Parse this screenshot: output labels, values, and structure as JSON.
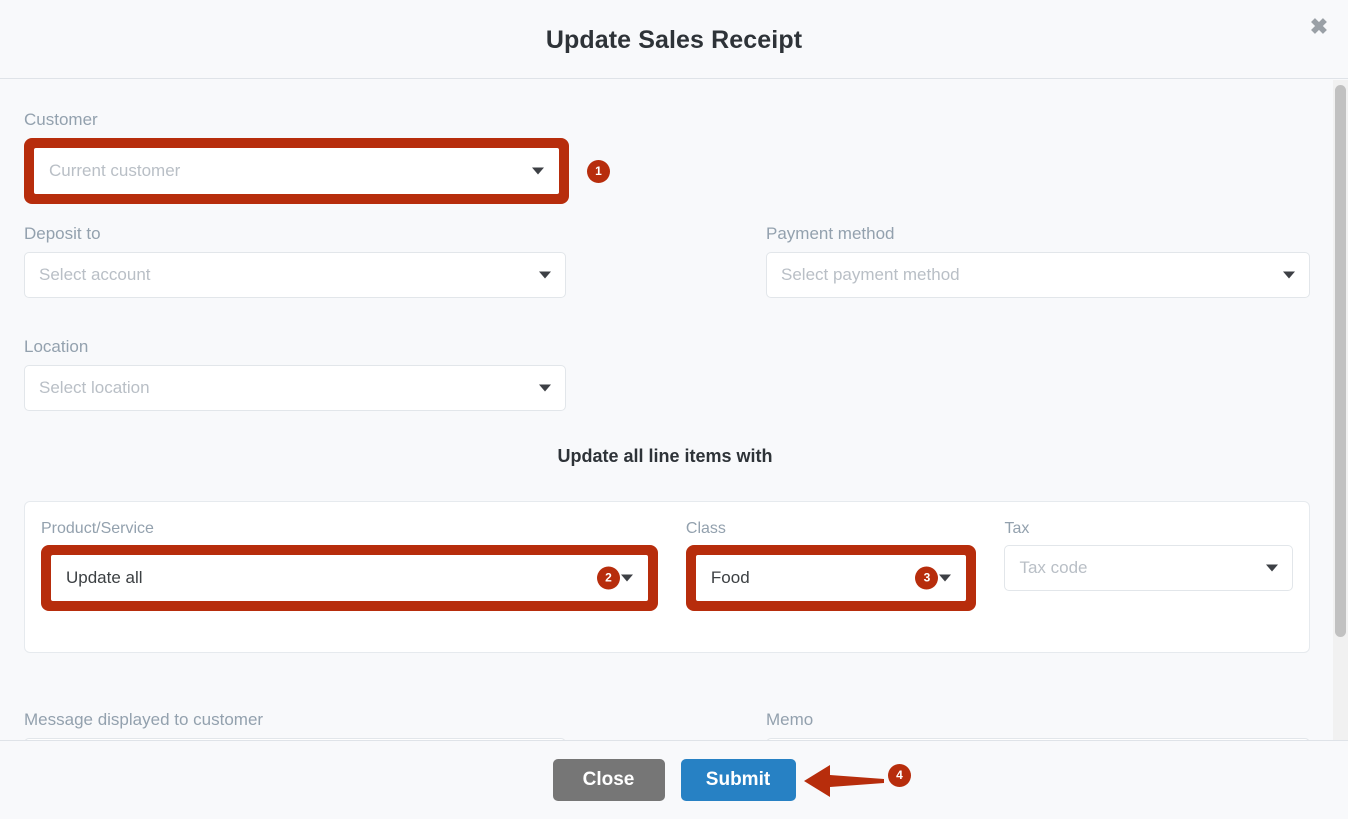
{
  "header": {
    "title": "Update Sales Receipt",
    "close_icon": "close-icon",
    "close_glyph": "✖"
  },
  "form": {
    "customer": {
      "label": "Customer",
      "placeholder": "Current customer",
      "value": "",
      "badge": "1",
      "highlighted": true
    },
    "deposit_to": {
      "label": "Deposit to",
      "placeholder": "Select account",
      "value": ""
    },
    "payment_method": {
      "label": "Payment method",
      "placeholder": "Select payment method",
      "value": ""
    },
    "location": {
      "label": "Location",
      "placeholder": "Select location",
      "value": ""
    }
  },
  "line_items_section": {
    "title": "Update all line items with",
    "product_service": {
      "label": "Product/Service",
      "value": "Update all",
      "badge": "2",
      "highlighted": true
    },
    "class": {
      "label": "Class",
      "value": "Food",
      "badge": "3",
      "highlighted": true
    },
    "tax": {
      "label": "Tax",
      "placeholder": "Tax code",
      "value": ""
    }
  },
  "bottom": {
    "message": {
      "label": "Message displayed to customer",
      "value": ""
    },
    "memo": {
      "label": "Memo",
      "value": ""
    }
  },
  "footer": {
    "close_label": "Close",
    "submit_label": "Submit",
    "arrow_badge": "4"
  },
  "colors": {
    "highlight_red": "#b72d0c",
    "submit_blue": "#2781c4",
    "close_gray": "#767676",
    "page_background": "#f8f9fb",
    "label_gray": "#93a1ae",
    "placeholder_gray": "#b9bfc6"
  }
}
